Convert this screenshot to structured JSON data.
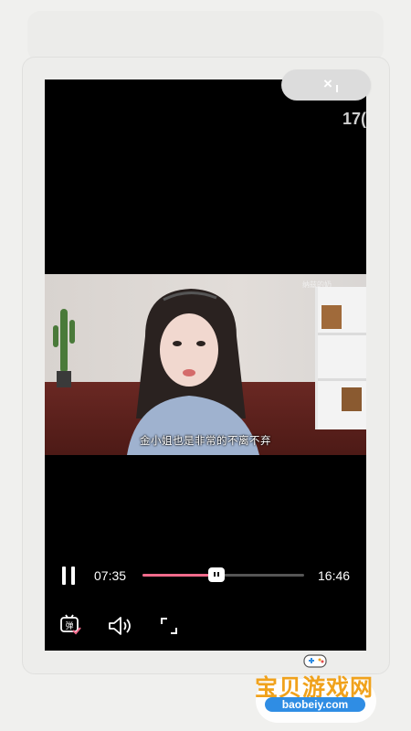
{
  "overlay": {
    "close_label": "×",
    "countdown_text": "17("
  },
  "video": {
    "subtitle": "金小姐也是非常的不离不弃",
    "uploader_watermark": "纳兹的奶"
  },
  "player": {
    "current_time": "07:35",
    "total_time": "16:46",
    "progress": 0.455,
    "danmaku_label": "弹"
  },
  "branding": {
    "site_name": "宝贝游戏网",
    "site_url": "baobeiy.com"
  },
  "colors": {
    "progress_fill": "#f06a8b",
    "logo_text": "#f0a21c",
    "logo_url_bg": "#2f8de4"
  }
}
